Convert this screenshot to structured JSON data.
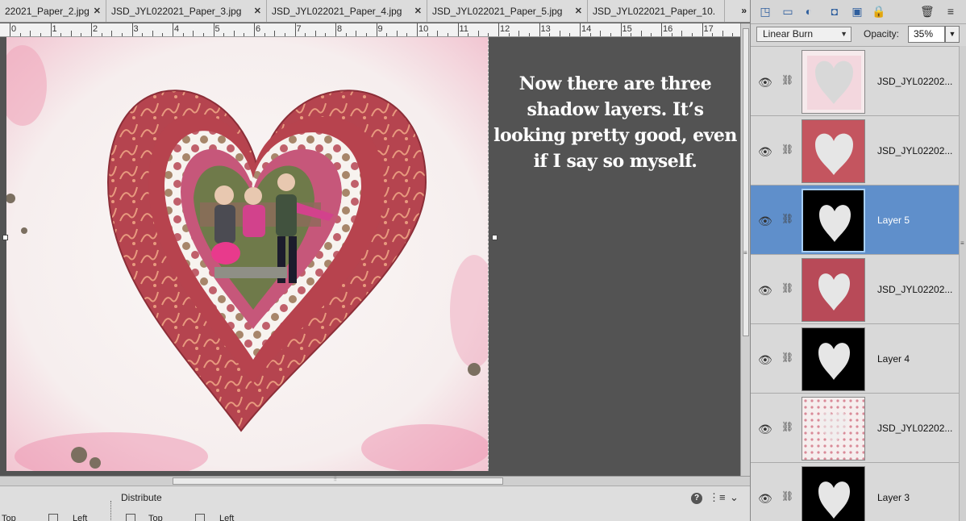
{
  "tabs": [
    {
      "label": "22021_Paper_2.jpg"
    },
    {
      "label": "JSD_JYL022021_Paper_3.jpg"
    },
    {
      "label": "JSD_JYL022021_Paper_4.jpg"
    },
    {
      "label": "JSD_JYL022021_Paper_5.jpg"
    },
    {
      "label": "JSD_JYL022021_Paper_10."
    }
  ],
  "tabs_overflow": "»",
  "ruler": {
    "labels": [
      "0",
      "1",
      "2",
      "3",
      "4",
      "5",
      "6",
      "7",
      "8",
      "9",
      "10",
      "11",
      "12",
      "13",
      "14",
      "15",
      "16",
      "17"
    ]
  },
  "caption": "Now there are three shadow layers. It’s looking pretty good, even if I say so myself.",
  "options_bar": {
    "distribute_label": "Distribute",
    "labels": [
      "Top",
      "Left",
      "Top",
      "Left"
    ],
    "help": "?"
  },
  "layers_panel": {
    "blend_mode": "Linear Burn",
    "opacity_label": "Opacity:",
    "opacity_value": "35%",
    "layers": [
      {
        "name": "JSD_JYL02202...",
        "thumb": "paper-frame",
        "selected": false
      },
      {
        "name": "JSD_JYL02202...",
        "thumb": "red-paper",
        "selected": false
      },
      {
        "name": "Layer 5",
        "thumb": "black-mask",
        "selected": true
      },
      {
        "name": "JSD_JYL02202...",
        "thumb": "red-paper-2",
        "selected": false
      },
      {
        "name": "Layer 4",
        "thumb": "black-mask",
        "selected": false
      },
      {
        "name": "JSD_JYL02202...",
        "thumb": "dotted-paper",
        "selected": false
      },
      {
        "name": "Layer 3",
        "thumb": "black-mask",
        "selected": false
      }
    ]
  },
  "colors": {
    "selected_layer": "#5f8fcb",
    "heart_outer": "#b8464f",
    "heart_inner": "#c95a78",
    "canvas_bg": "#535353"
  }
}
